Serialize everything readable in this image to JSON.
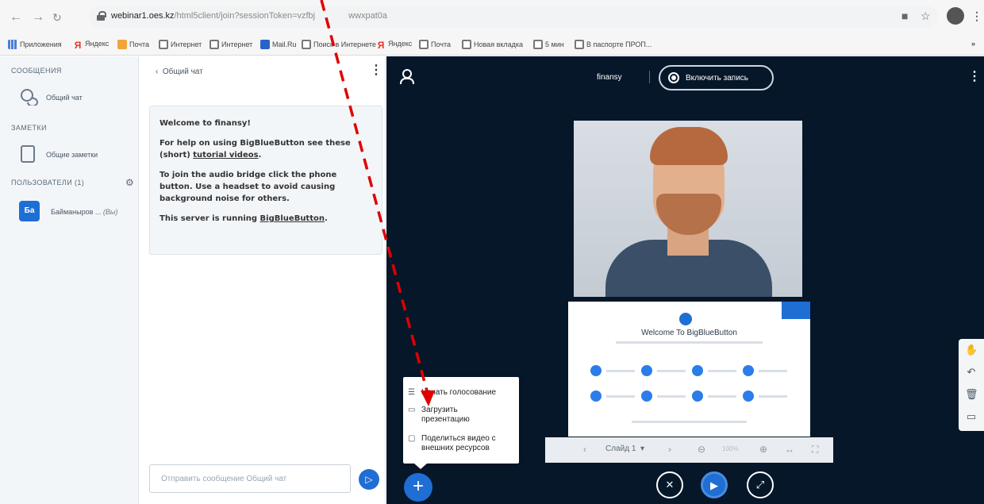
{
  "browser": {
    "url_host": "webinar1.oes.kz",
    "url_path": "/html5client/join?sessionToken=vzfbj",
    "url_tail": "wwxpat0a",
    "bookmarks": [
      "Приложения",
      "Яндекс",
      "Почта",
      "Интернет",
      "Интернет",
      "Mail.Ru",
      "Поиск в Интернете",
      "Яндекс",
      "Почта",
      "Новая вкладка",
      "5 мин",
      "В паспорте ПРОП..."
    ]
  },
  "sidebar": {
    "messages_title": "СООБЩЕНИЯ",
    "public_chat": "Общий чат",
    "notes_title": "ЗАМЕТКИ",
    "shared_notes": "Общие заметки",
    "users_title": "ПОЛЬЗОВАТЕЛИ (1)",
    "user_initials": "Ба",
    "user_name": "Байманыров ...",
    "user_role": "(Вы)"
  },
  "chat": {
    "header": "Общий чат",
    "welcome_title": "Welcome to finansy!",
    "help_prefix": "For help on using BigBlueButton see these (short) ",
    "help_link": "tutorial videos",
    "help_suffix": ".",
    "audio_text": "To join the audio bridge click the phone button. Use a headset to avoid causing background noise for others.",
    "server_prefix": "This server is running ",
    "server_link": "BigBlueButton",
    "server_suffix": ".",
    "input_placeholder": "Отправить сообщение Общий чат"
  },
  "main": {
    "meeting_name": "finansy",
    "record_label": "Включить запись",
    "slide_title": "Welcome To BigBlueButton",
    "slide_select": "Слайд 1",
    "zoom": "100%"
  },
  "actions_menu": {
    "items": [
      {
        "label": "Начать голосование",
        "icon": "poll-icon"
      },
      {
        "label": "Загрузить презентацию",
        "icon": "presentation-icon"
      },
      {
        "label": "Поделиться видео с внешних ресурсов",
        "icon": "external-video-icon"
      }
    ]
  },
  "colors": {
    "accent": "#1f6ed4",
    "main_bg": "#06172a",
    "annotation": "#e00000"
  }
}
